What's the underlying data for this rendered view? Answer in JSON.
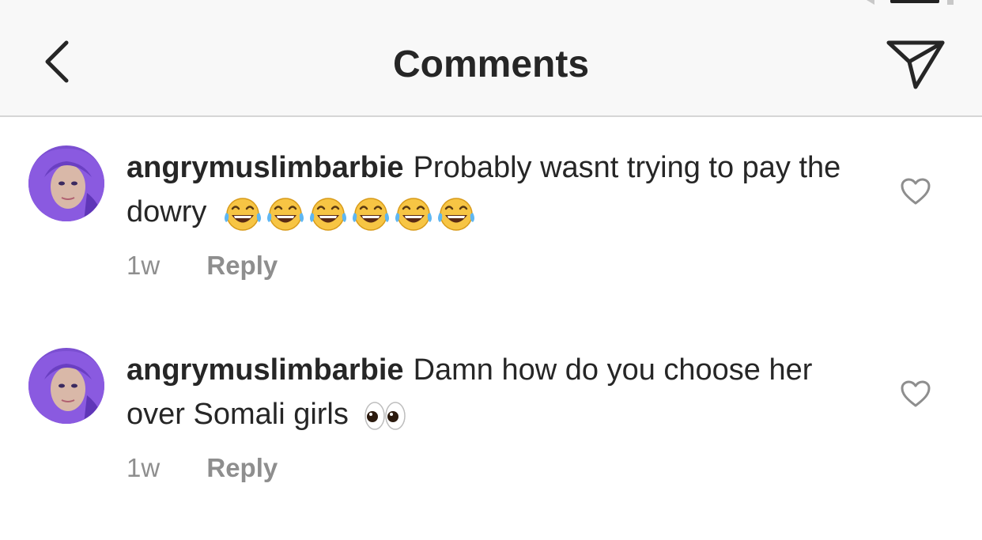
{
  "header": {
    "title": "Comments",
    "back_icon": "chevron-left-icon",
    "send_icon": "paper-plane-icon"
  },
  "comments": [
    {
      "username": "angrymuslimbarbie",
      "text": "Probably wasnt trying to pay the dowry",
      "emojis": [
        "😂",
        "😂",
        "😂",
        "😂",
        "😂",
        "😂"
      ],
      "time": "1w",
      "reply_label": "Reply",
      "like_icon": "heart-outline-icon"
    },
    {
      "username": "angrymuslimbarbie",
      "text": "Damn how do you choose her over Somali girls",
      "emojis": [
        "👀"
      ],
      "time": "1w",
      "reply_label": "Reply",
      "like_icon": "heart-outline-icon"
    }
  ],
  "colors": {
    "header_bg": "#f8f8f8",
    "text": "#262626",
    "secondary": "#8e8e8e",
    "avatar_purple": "#7b4fd1"
  }
}
